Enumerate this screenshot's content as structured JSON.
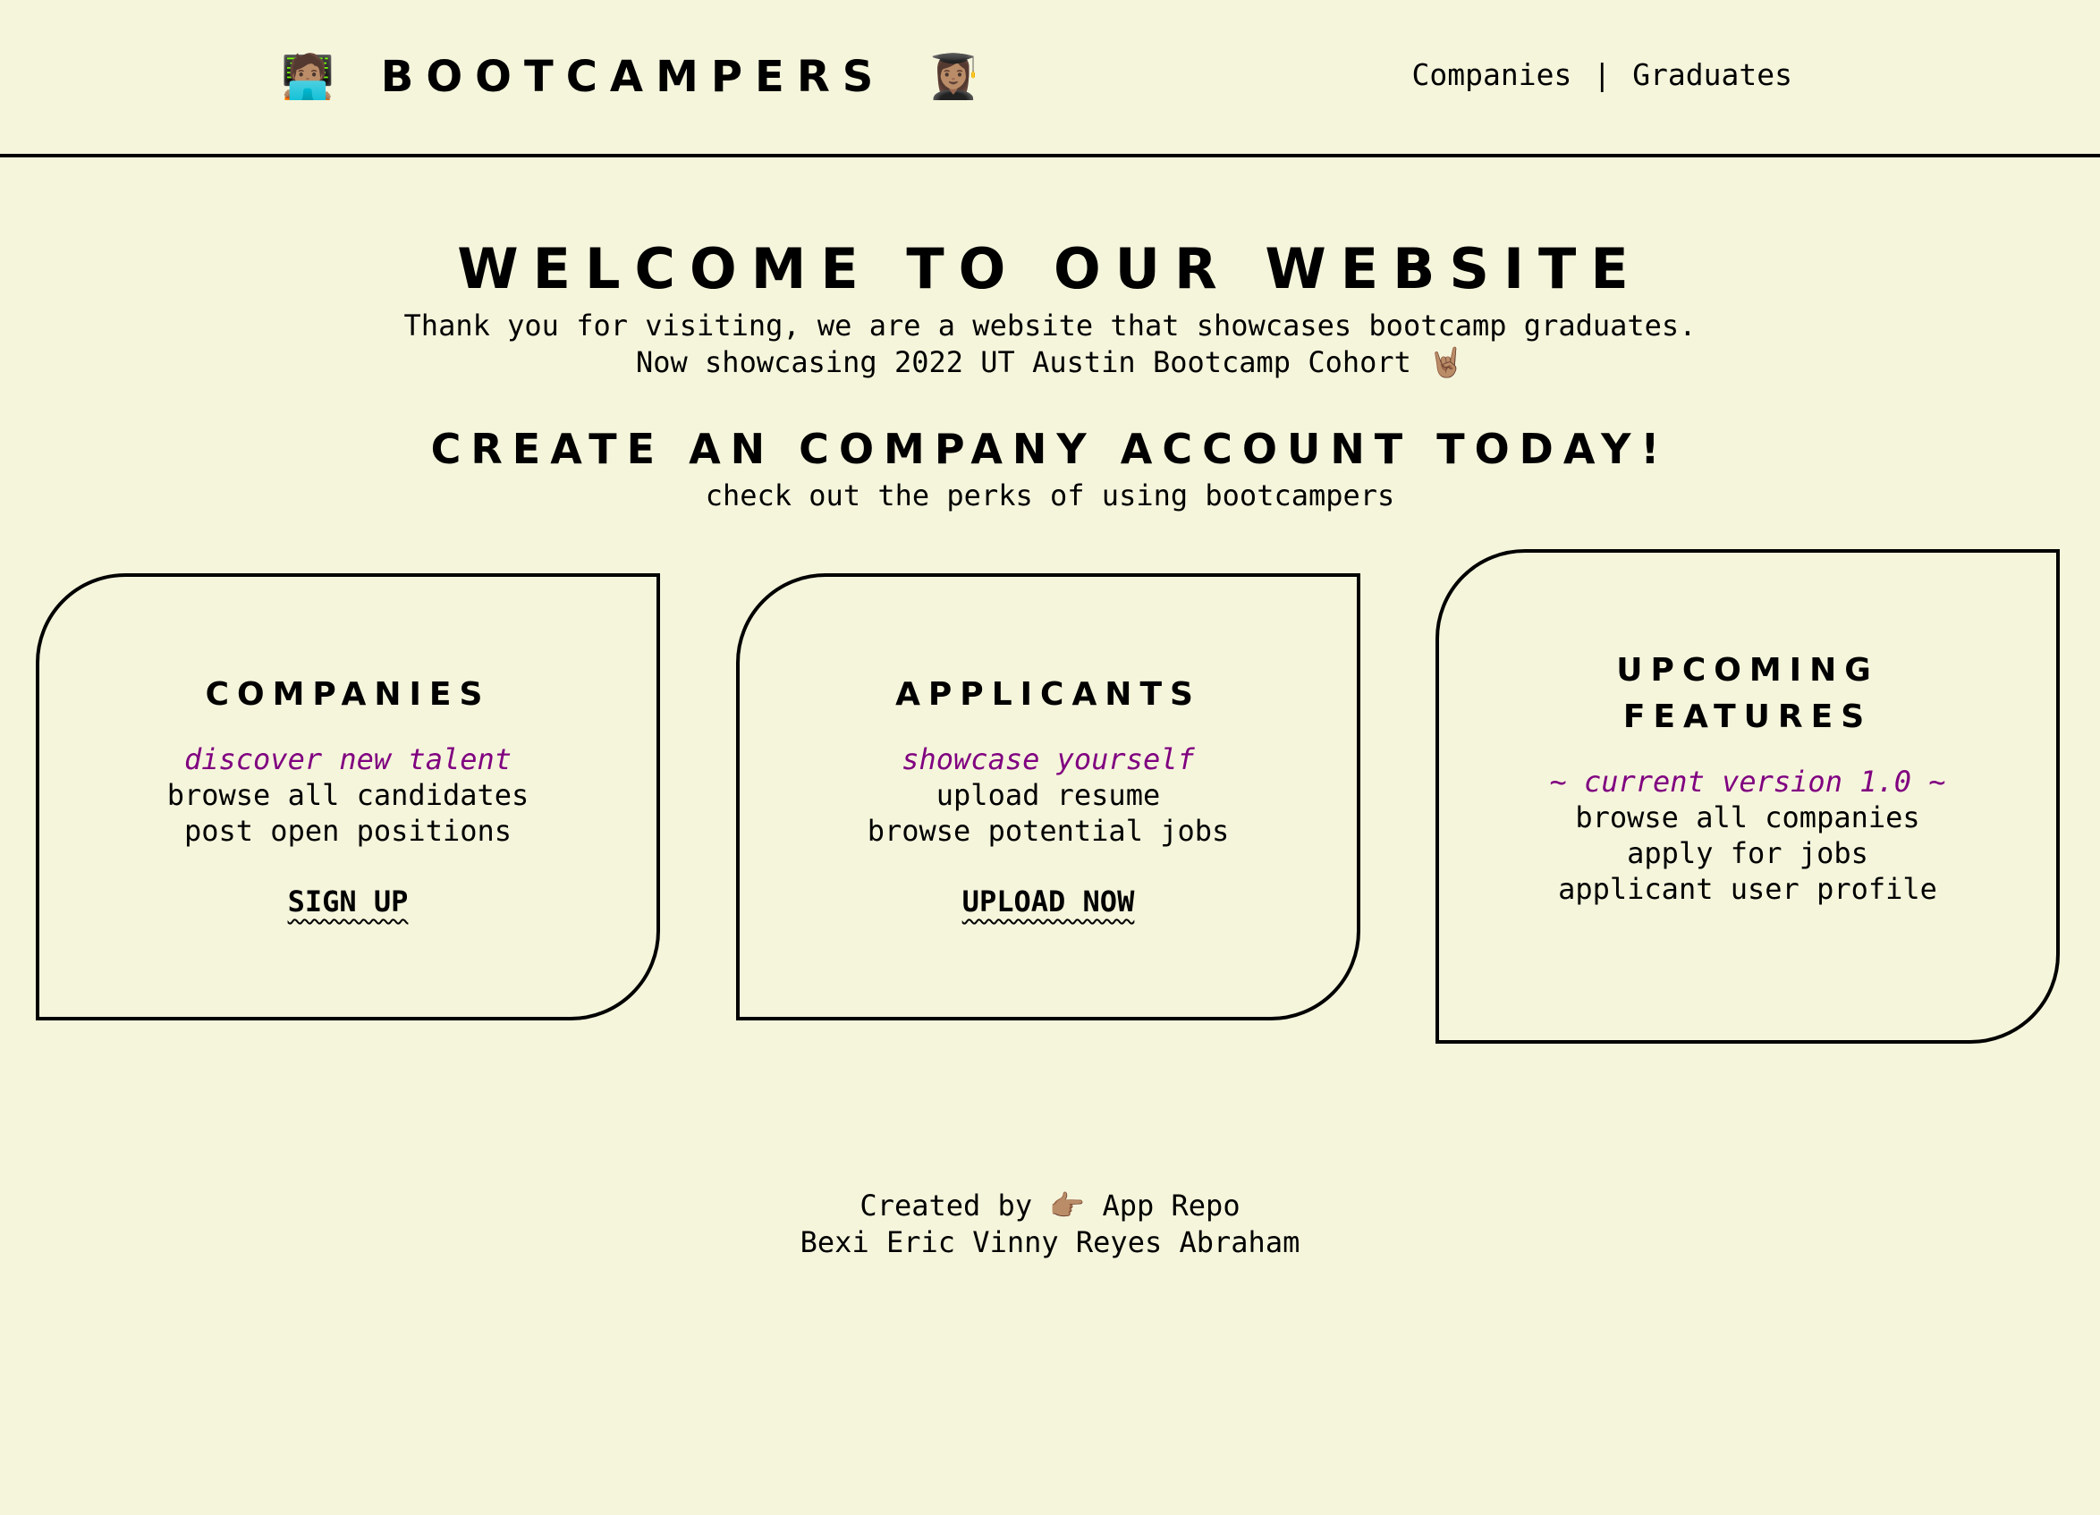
{
  "header": {
    "left_emoji": "🧑🏽‍💻",
    "brand": "BOOTCAMPERS",
    "right_emoji": "👩🏽‍🎓",
    "nav": {
      "companies": "Companies",
      "separator": "|",
      "graduates": "Graduates"
    }
  },
  "hero": {
    "title": "WELCOME TO OUR WEBSITE",
    "line1": "Thank you for visiting, we are a website that showcases bootcamp graduates.",
    "line2": "Now showcasing 2022 UT Austin Bootcamp Cohort 🤘🏽"
  },
  "section": {
    "title": "CREATE AN COMPANY ACCOUNT TODAY!",
    "subtitle": "check out the perks of using bootcampers"
  },
  "cards": {
    "companies": {
      "title": "COMPANIES",
      "tagline": "discover new talent",
      "features": [
        "browse all candidates",
        "post open positions"
      ],
      "cta": "SIGN UP"
    },
    "applicants": {
      "title": "APPLICANTS",
      "tagline": "showcase yourself",
      "features": [
        "upload resume",
        "browse potential jobs"
      ],
      "cta": "UPLOAD NOW"
    },
    "upcoming": {
      "title_line1": "UPCOMING",
      "title_line2": "FEATURES",
      "tagline": "~ current version 1.0 ~",
      "features": [
        "browse all companies",
        "apply for jobs",
        "applicant user profile"
      ]
    }
  },
  "footer": {
    "created_by": "Created by",
    "pointer_emoji": "👉🏽",
    "repo_link": "App Repo",
    "authors": "Bexi Eric Vinny Reyes Abraham"
  },
  "colors": {
    "background": "#f5f5dc",
    "accent": "#800080",
    "text": "#000000"
  }
}
